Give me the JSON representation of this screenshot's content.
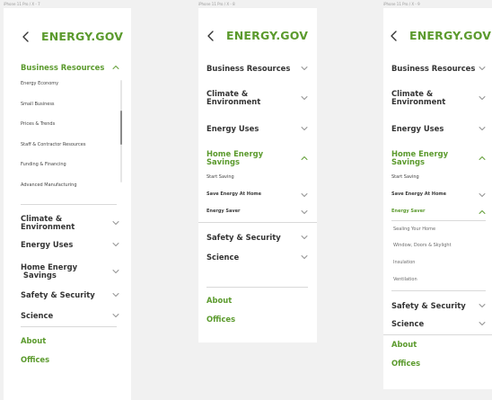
{
  "frames": [
    {
      "label": "iPhone 11 Pro / X - 7",
      "brand": "ENERGY.GOV",
      "business": {
        "label": "Business Resources",
        "chevron": "chevron-up-icon"
      },
      "sub_items": [
        "Energy Economy",
        "Small Business",
        "Prices & Trends",
        "Staff & Contractor Resources",
        "Funding & Financing",
        "Advanced Manufacturing"
      ],
      "climate": "Climate &\nEnvironment",
      "uses": "Energy Uses",
      "home": "Home Energy\n Savings",
      "safety": "Safety & Security",
      "science": "Science",
      "about": "About",
      "offices": "Offices"
    },
    {
      "label": "iPhone 11 Pro / X - 8",
      "brand": "ENERGY.GOV",
      "business": "Business Resources",
      "climate": "Climate &\nEnvironment",
      "uses": "Energy Uses",
      "home": "Home Energy\nSavings",
      "sub_items": [
        "Start Saving",
        "Save Energy At Home",
        "Energy Saver"
      ],
      "safety": "Safety & Security",
      "science": "Science",
      "about": "About",
      "offices": "Offices"
    },
    {
      "label": "iPhone 11 Pro / X - 9",
      "brand": "ENERGY.GOV",
      "business": "Business Resources",
      "climate": "Climate &\nEnvironment",
      "uses": "Energy Uses",
      "home": "Home Energy\nSavings",
      "sub_items": [
        "Start Saving",
        "Save Energy At Home",
        "Energy Saver"
      ],
      "saver_items": [
        "Sealing Your Home",
        "Window, Doors & Skylight",
        "Insulation",
        "Ventilation"
      ],
      "safety": "Safety & Security",
      "science": "Science",
      "about": "About",
      "offices": "Offices"
    }
  ],
  "colors": {
    "accent": "#5b9a2d",
    "text": "#343434",
    "divider": "#d9d9d9",
    "background": "#f1f1f1"
  }
}
